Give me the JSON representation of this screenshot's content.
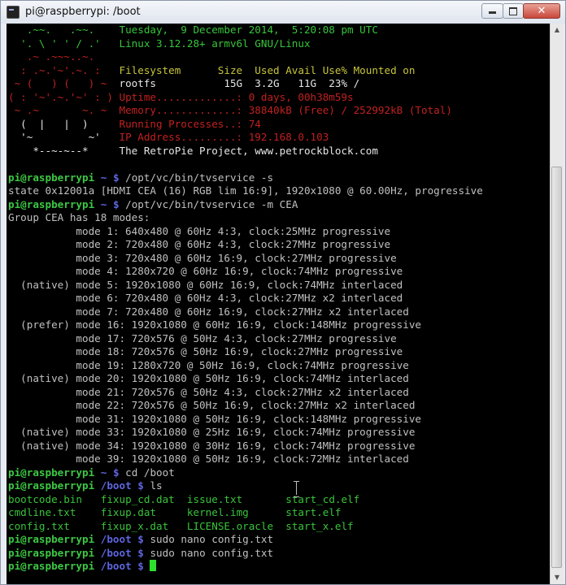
{
  "window": {
    "title": "pi@raspberrypi: /boot",
    "min_glyph": "",
    "close_glyph": "✕"
  },
  "motd": {
    "art": [
      "   .~~.   .~~.  ",
      "  '. \\ ' ' / .' ",
      "   .~ .~~~..~.  ",
      "  : .~.'~'.~. : ",
      " ~ (   ) (   ) ~",
      "( : '~'.~.'~' : )",
      " ~ .~       ~. ~ ",
      "  (  |   |  )   ",
      "  '~         ~' ",
      "    *--~-~--*   "
    ],
    "art_colors": [
      "g",
      "g",
      "r",
      "r",
      "r",
      "r",
      "r",
      "wb",
      "wb",
      "wb"
    ],
    "lines": [
      {
        "text": "Tuesday,  9 December 2014,  5:20:08 pm UTC",
        "color": "g"
      },
      {
        "text": "Linux 3.12.28+ armv6l GNU/Linux",
        "color": "g"
      },
      {
        "text": "",
        "color": "w"
      },
      {
        "text": "Filesystem      Size  Used Avail Use% Mounted on",
        "color": "y"
      },
      {
        "text": "rootfs           15G  3.2G   11G  23% /",
        "color": "wb"
      },
      {
        "text": "Uptime.............: 0 days, 00h38m59s",
        "color": "r"
      },
      {
        "text": "Memory.............: 38840kB (Free) / 252992kB (Total)",
        "color": "r"
      },
      {
        "text": "Running Processes..: 74",
        "color": "r"
      },
      {
        "text": "IP Address.........: 192.168.0.103",
        "color": "r"
      },
      {
        "text": "The RetroPie Project, www.petrockblock.com",
        "color": "wb"
      }
    ]
  },
  "prompt": {
    "user_host": "pi@raspberrypi",
    "home_dir": "~",
    "boot_dir": "/boot",
    "symbol": "$"
  },
  "session": [
    {
      "kind": "blank"
    },
    {
      "kind": "cmd",
      "dir": "~",
      "cmd": "/opt/vc/bin/tvservice -s"
    },
    {
      "kind": "out",
      "text": "state 0x12001a [HDMI CEA (16) RGB lim 16:9], 1920x1080 @ 60.00Hz, progressive"
    },
    {
      "kind": "cmd",
      "dir": "~",
      "cmd": "/opt/vc/bin/tvservice -m CEA"
    },
    {
      "kind": "out",
      "text": "Group CEA has 18 modes:"
    },
    {
      "kind": "out",
      "text": "           mode 1: 640x480 @ 60Hz 4:3, clock:25MHz progressive"
    },
    {
      "kind": "out",
      "text": "           mode 2: 720x480 @ 60Hz 4:3, clock:27MHz progressive"
    },
    {
      "kind": "out",
      "text": "           mode 3: 720x480 @ 60Hz 16:9, clock:27MHz progressive"
    },
    {
      "kind": "out",
      "text": "           mode 4: 1280x720 @ 60Hz 16:9, clock:74MHz progressive"
    },
    {
      "kind": "out",
      "text": "  (native) mode 5: 1920x1080 @ 60Hz 16:9, clock:74MHz interlaced"
    },
    {
      "kind": "out",
      "text": "           mode 6: 720x480 @ 60Hz 4:3, clock:27MHz x2 interlaced"
    },
    {
      "kind": "out",
      "text": "           mode 7: 720x480 @ 60Hz 16:9, clock:27MHz x2 interlaced"
    },
    {
      "kind": "out",
      "text": "  (prefer) mode 16: 1920x1080 @ 60Hz 16:9, clock:148MHz progressive"
    },
    {
      "kind": "out",
      "text": "           mode 17: 720x576 @ 50Hz 4:3, clock:27MHz progressive"
    },
    {
      "kind": "out",
      "text": "           mode 18: 720x576 @ 50Hz 16:9, clock:27MHz progressive"
    },
    {
      "kind": "out",
      "text": "           mode 19: 1280x720 @ 50Hz 16:9, clock:74MHz progressive"
    },
    {
      "kind": "out",
      "text": "  (native) mode 20: 1920x1080 @ 50Hz 16:9, clock:74MHz interlaced"
    },
    {
      "kind": "out",
      "text": "           mode 21: 720x576 @ 50Hz 4:3, clock:27MHz x2 interlaced"
    },
    {
      "kind": "out",
      "text": "           mode 22: 720x576 @ 50Hz 16:9, clock:27MHz x2 interlaced"
    },
    {
      "kind": "out",
      "text": "           mode 31: 1920x1080 @ 50Hz 16:9, clock:148MHz progressive"
    },
    {
      "kind": "out",
      "text": "  (native) mode 33: 1920x1080 @ 25Hz 16:9, clock:74MHz progressive"
    },
    {
      "kind": "out",
      "text": "  (native) mode 34: 1920x1080 @ 30Hz 16:9, clock:74MHz progressive"
    },
    {
      "kind": "out",
      "text": "           mode 39: 1920x1080 @ 50Hz 16:9, clock:72MHz interlaced"
    },
    {
      "kind": "cmd",
      "dir": "~",
      "cmd": "cd /boot"
    },
    {
      "kind": "cmd",
      "dir": "/boot",
      "cmd": "ls"
    },
    {
      "kind": "ls",
      "cols": [
        {
          "text": "bootcode.bin",
          "color": "g"
        },
        {
          "text": "fixup_cd.dat",
          "color": "g"
        },
        {
          "text": "issue.txt",
          "color": "g"
        },
        {
          "text": "start_cd.elf",
          "color": "g"
        }
      ]
    },
    {
      "kind": "ls",
      "cols": [
        {
          "text": "cmdline.txt",
          "color": "g"
        },
        {
          "text": "fixup.dat",
          "color": "g"
        },
        {
          "text": "kernel.img",
          "color": "g"
        },
        {
          "text": "start.elf",
          "color": "g"
        }
      ]
    },
    {
      "kind": "ls",
      "cols": [
        {
          "text": "config.txt",
          "color": "g"
        },
        {
          "text": "fixup_x.dat",
          "color": "g"
        },
        {
          "text": "LICENSE.oracle",
          "color": "g"
        },
        {
          "text": "start_x.elf",
          "color": "g"
        }
      ]
    },
    {
      "kind": "cmd",
      "dir": "/boot",
      "cmd": "sudo nano config.txt"
    },
    {
      "kind": "cmd",
      "dir": "/boot",
      "cmd": "sudo nano config.txt"
    },
    {
      "kind": "cmd",
      "dir": "/boot",
      "cmd": "",
      "cursor": true
    }
  ]
}
